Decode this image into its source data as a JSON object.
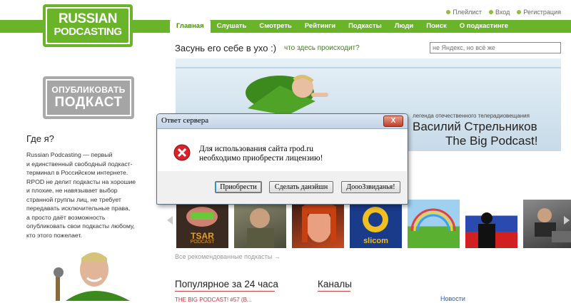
{
  "top_links": [
    {
      "label": "Плейлист",
      "color": "#8cbf3f"
    },
    {
      "label": "Вход",
      "color": "#8cbf3f"
    },
    {
      "label": "Регистрация",
      "color": "#8cbf3f"
    }
  ],
  "logo": {
    "line1": "RUSSIAN",
    "line2": "PODCASTING",
    "color": "#6ab42a"
  },
  "nav": {
    "tabs": [
      "Главная",
      "Слушать",
      "Смотреть",
      "Рейтинги",
      "Подкасты",
      "Люди",
      "Поиск",
      "О подкастинге"
    ],
    "active": "Главная"
  },
  "header": {
    "slogan": "Засунь его себе в ухо :)",
    "slogan_link": "что здесь происходит?",
    "search_placeholder": "не Яндекс, но всё же"
  },
  "banner": {
    "caption": "легенда отечественного телерадиовещания",
    "name": "Василий Стрельников",
    "subtitle": "The Big Podcast!"
  },
  "publish": {
    "line1": "ОПУБЛИКОВАТЬ",
    "line2": "ПОДКАСТ"
  },
  "where": {
    "heading": "Где я?",
    "lines": [
      "Russian Podcasting — первый",
      "и единственный свободный подкаст-",
      "терминал в Российском интернете.",
      "RPOD не делит подкасты на хорошие",
      "и плохие, не навязывает выбор",
      "странной группы лиц, не требует",
      "передавать исключительные права,",
      "а просто даёт возможность",
      "опубликовать свои подкасты любому,",
      "кто этого пожелает."
    ]
  },
  "thumbnails": {
    "items": [
      "tsar-podcast",
      "soldier",
      "red-hair-girl",
      "slicom",
      "rainbow",
      "russian-flag",
      "man-at-desk"
    ],
    "tsar_label": "TSAR",
    "tsar_sub": "PODCAST",
    "slicom_label": "slicom",
    "all_recommended": "Все рекомендованные подкасты →"
  },
  "lower": {
    "popular_heading": "Популярное за 24 часа",
    "channels_heading": "Каналы",
    "news_link": "Новости",
    "popular_first": "THE BIG PODCAST! #57 (B..."
  },
  "dialog": {
    "title": "Ответ сервера",
    "close_label": "X",
    "message_line1": "Для использования сайта rpod.ru",
    "message_line2": "необходимо приобрести лицензию!",
    "buttons": [
      "Приобрести",
      "Сделать данэйшн",
      "ДоооЗзвиданья!"
    ]
  }
}
